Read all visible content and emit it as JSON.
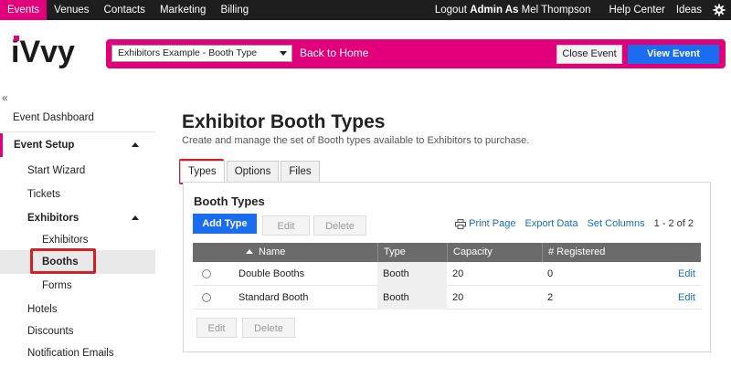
{
  "topnav": {
    "items": [
      "Events",
      "Venues",
      "Contacts",
      "Marketing",
      "Billing"
    ],
    "logout_prefix": "Logout ",
    "logout_admin": "Admin As",
    "logout_user": " Mel Thompson",
    "help": "Help Center",
    "ideas": "Ideas",
    "settings_icon": "gear-icon"
  },
  "header": {
    "logo": "iVvy",
    "event_select": "Exhibitors Example - Booth Type",
    "back_home": "Back to Home",
    "close_event": "Close Event",
    "view_site": "View Event Website"
  },
  "sidebar": {
    "collapse": "«",
    "items": [
      {
        "label": "Event Dashboard"
      },
      {
        "label": "Event Setup"
      },
      {
        "label": "Start Wizard"
      },
      {
        "label": "Tickets"
      },
      {
        "label": "Exhibitors"
      },
      {
        "label": "Exhibitors"
      },
      {
        "label": "Booths"
      },
      {
        "label": "Forms"
      },
      {
        "label": "Hotels"
      },
      {
        "label": "Discounts"
      },
      {
        "label": "Notification Emails"
      }
    ]
  },
  "main": {
    "title": "Exhibitor Booth Types",
    "subtitle": "Create and manage the set of Booth types available to Exhibitors to purchase.",
    "tabs": [
      "Types",
      "Options",
      "Files"
    ],
    "panel_title": "Booth Types",
    "add_type": "Add Type",
    "edit": "Edit",
    "delete": "Delete",
    "print_page": "Print Page",
    "export_data": "Export Data",
    "set_columns": "Set Columns",
    "count": "1 - 2 of 2",
    "columns": [
      "Name",
      "Type",
      "Capacity",
      "# Registered"
    ],
    "rows": [
      {
        "name": "Double Booths",
        "type": "Booth",
        "capacity": "20",
        "registered": "0",
        "action": "Edit"
      },
      {
        "name": "Standard Booth",
        "type": "Booth",
        "capacity": "20",
        "registered": "2",
        "action": "Edit"
      }
    ],
    "bottom_edit": "Edit",
    "bottom_delete": "Delete"
  },
  "colors": {
    "brand": "#e2007a",
    "primary": "#1a6cf0",
    "highlight": "#d41f26",
    "nav_bg": "#1e1e1e"
  }
}
